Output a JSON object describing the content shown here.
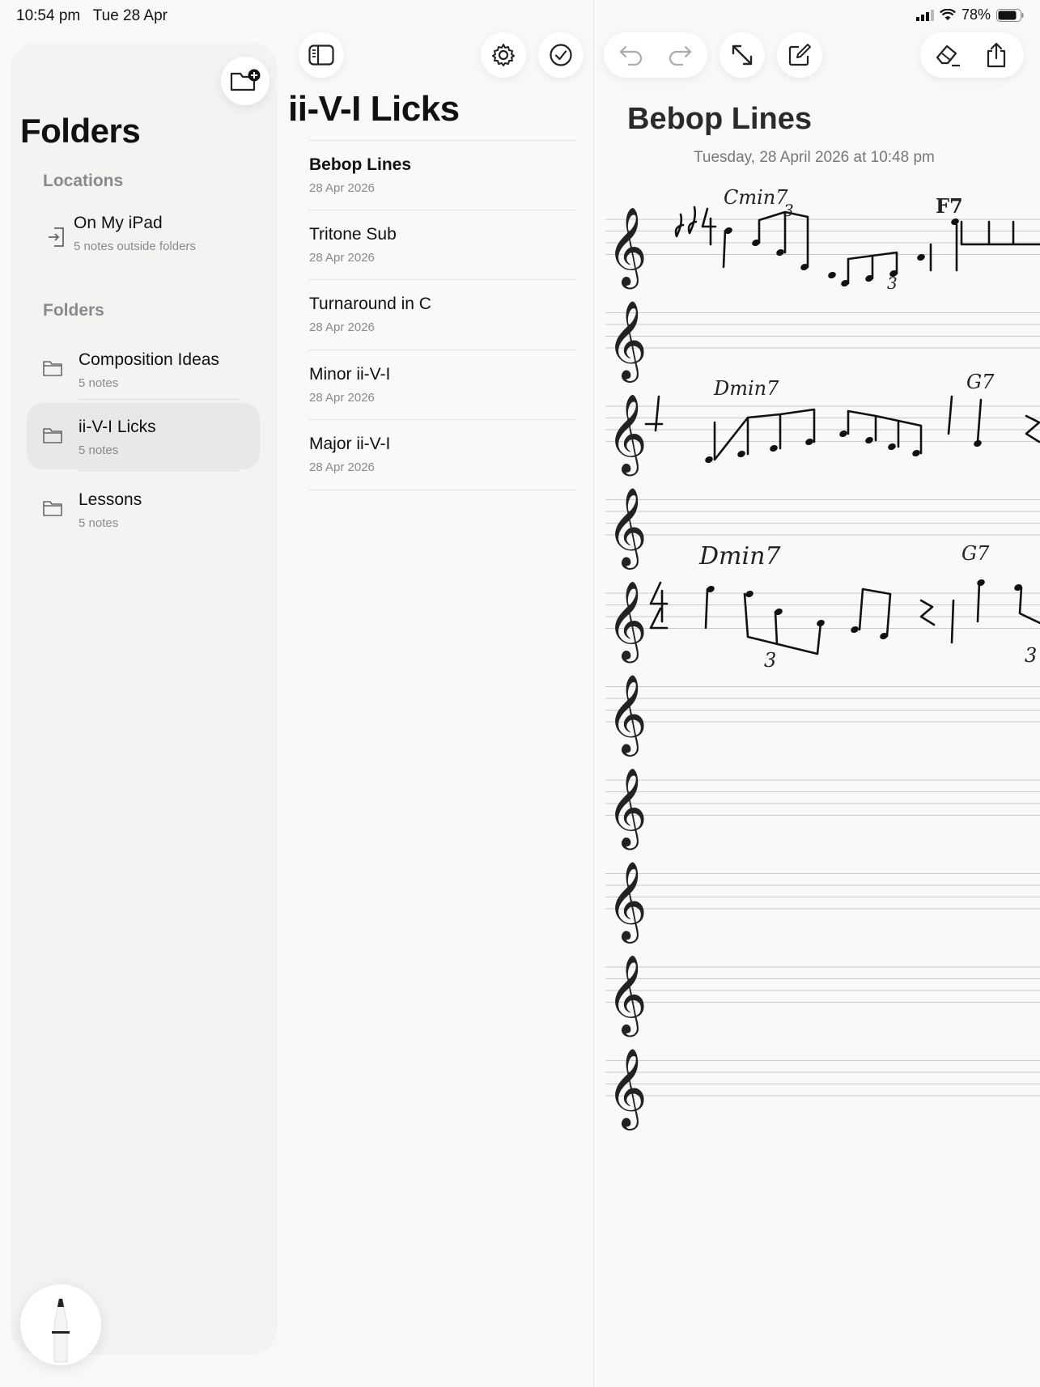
{
  "status_bar": {
    "time": "10:54 pm",
    "date": "Tue 28 Apr",
    "battery": "78%"
  },
  "sidebar": {
    "title": "Folders",
    "locations_header": "Locations",
    "location": {
      "title": "On My iPad",
      "subtitle": "5 notes outside folders"
    },
    "folders_header": "Folders",
    "folders": [
      {
        "title": "Composition Ideas",
        "subtitle": "5 notes"
      },
      {
        "title": "ii-V-I Licks",
        "subtitle": "5 notes"
      },
      {
        "title": "Lessons",
        "subtitle": "5 notes"
      }
    ]
  },
  "note_list": {
    "title": "ii-V-I Licks",
    "notes": [
      {
        "title": "Bebop Lines",
        "date": "28 Apr 2026"
      },
      {
        "title": "Tritone Sub",
        "date": "28 Apr 2026"
      },
      {
        "title": "Turnaround in C",
        "date": "28 Apr 2026"
      },
      {
        "title": "Minor ii-V-I",
        "date": "28 Apr 2026"
      },
      {
        "title": "Major ii-V-I",
        "date": "28 Apr 2026"
      }
    ]
  },
  "note": {
    "title": "Bebop Lines",
    "date": "Tuesday, 28 April 2026 at 10:48 pm",
    "chords": [
      "Cmin7",
      "F7",
      "Dmin7",
      "G7",
      "Dmin7",
      "G7"
    ],
    "triplet_marks": [
      "3",
      "3",
      "3",
      "3"
    ]
  },
  "icons": {
    "new_folder": "folder-plus-icon",
    "sidebar_toggle": "sidebar-icon",
    "settings": "gear-icon",
    "select": "checkmark-circle-icon",
    "undo": "undo-icon",
    "redo": "redo-icon",
    "expand": "expand-icon",
    "compose": "compose-icon",
    "eraser": "eraser-icon",
    "share": "share-icon",
    "pencil": "pencil-icon"
  }
}
